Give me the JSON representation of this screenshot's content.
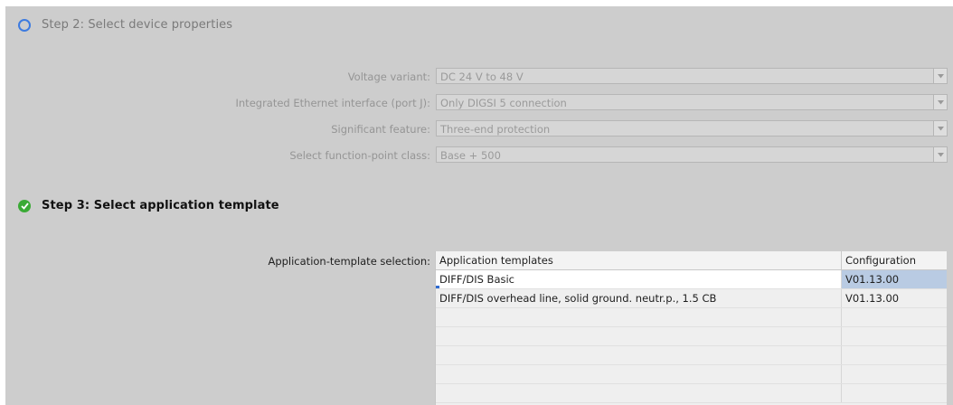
{
  "step2": {
    "title": "Step 2: Select device properties",
    "icon": "circle-outline-icon"
  },
  "properties": [
    {
      "label": "Voltage variant:",
      "value": "DC 24 V to 48 V"
    },
    {
      "label": "Integrated Ethernet interface (port J):",
      "value": "Only DIGSI 5 connection"
    },
    {
      "label": "Significant feature:",
      "value": "Three-end protection"
    },
    {
      "label": "Select function-point class:",
      "value": "Base + 500"
    }
  ],
  "step3": {
    "title": "Step 3: Select application template",
    "icon": "check-circle-icon"
  },
  "templates": {
    "label": "Application-template selection:",
    "columns": [
      "Application templates",
      "Configuration"
    ],
    "rows": [
      {
        "name": "DIFF/DIS Basic",
        "config": "V01.13.00",
        "selected": true
      },
      {
        "name": "DIFF/DIS overhead line, solid ground. neutr.p., 1.5 CB",
        "config": "V01.13.00",
        "selected": false
      },
      {
        "name": "",
        "config": ""
      },
      {
        "name": "",
        "config": ""
      },
      {
        "name": "",
        "config": ""
      },
      {
        "name": "",
        "config": ""
      },
      {
        "name": "",
        "config": ""
      }
    ]
  },
  "colors": {
    "accent": "#3d7be0",
    "success": "#3aaa35",
    "selection": "#b9cbe3"
  }
}
